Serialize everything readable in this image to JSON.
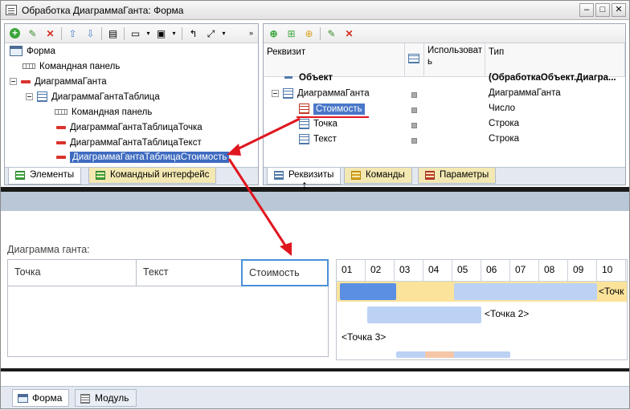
{
  "window": {
    "title": "Обработка ДиаграммаГанта: Форма",
    "minimize": "–",
    "maximize": "□",
    "close": "✕"
  },
  "left_panel": {
    "tree": [
      {
        "label": "Форма",
        "icon": "form-icon"
      },
      {
        "label": "Командная панель",
        "icon": "command-panel-icon"
      },
      {
        "label": "ДиаграммаГанта",
        "icon": "field-icon"
      },
      {
        "label": "ДиаграммаГантаТаблица",
        "icon": "table-icon"
      },
      {
        "label": "Командная панель",
        "icon": "command-panel-icon"
      },
      {
        "label": "ДиаграммаГантаТаблицаТочка",
        "icon": "field-icon"
      },
      {
        "label": "ДиаграммаГантаТаблицаТекст",
        "icon": "field-icon"
      },
      {
        "label": "ДиаграммаГантаТаблицаСтоимость",
        "icon": "field-icon",
        "selected": true
      }
    ],
    "tabs": [
      {
        "label": "Элементы",
        "active": true
      },
      {
        "label": "Командный интерфейс",
        "active": false
      }
    ]
  },
  "right_panel": {
    "columns": [
      "Реквизит",
      "Использоват ь",
      "Тип"
    ],
    "rows": [
      {
        "name": "Объект",
        "type": "(ОбработкаОбъект.Диагра...",
        "bold": true
      },
      {
        "name": "ДиаграммаГанта",
        "type": "ДиаграммаГанта"
      },
      {
        "name": "Стоимость",
        "type": "Число",
        "selected": true
      },
      {
        "name": "Точка",
        "type": "Строка"
      },
      {
        "name": "Текст",
        "type": "Строка"
      }
    ],
    "tabs": [
      {
        "label": "Реквизиты",
        "active": true
      },
      {
        "label": "Команды",
        "active": false
      },
      {
        "label": "Параметры",
        "active": false
      }
    ]
  },
  "preview": {
    "caption": "Диаграмма ганта:",
    "table_columns": [
      "Точка",
      "Текст",
      "Стоимость"
    ],
    "gantt_periods": [
      "01",
      "02",
      "03",
      "04",
      "05",
      "06",
      "07",
      "08",
      "09",
      "10"
    ],
    "bar_labels": [
      "<Точк",
      "<Точка 2>",
      "<Точка 3>"
    ],
    "colors": {
      "bar_dark": "#5b8fe3",
      "bar_light": "#bcd2f5",
      "bar_yellow": "#fbe39b",
      "highlight_border": "#4a90d9",
      "arrow": "#e0161f"
    }
  },
  "bottom_tabs": [
    {
      "label": "Форма",
      "active": true
    },
    {
      "label": "Модуль",
      "active": false
    }
  ]
}
